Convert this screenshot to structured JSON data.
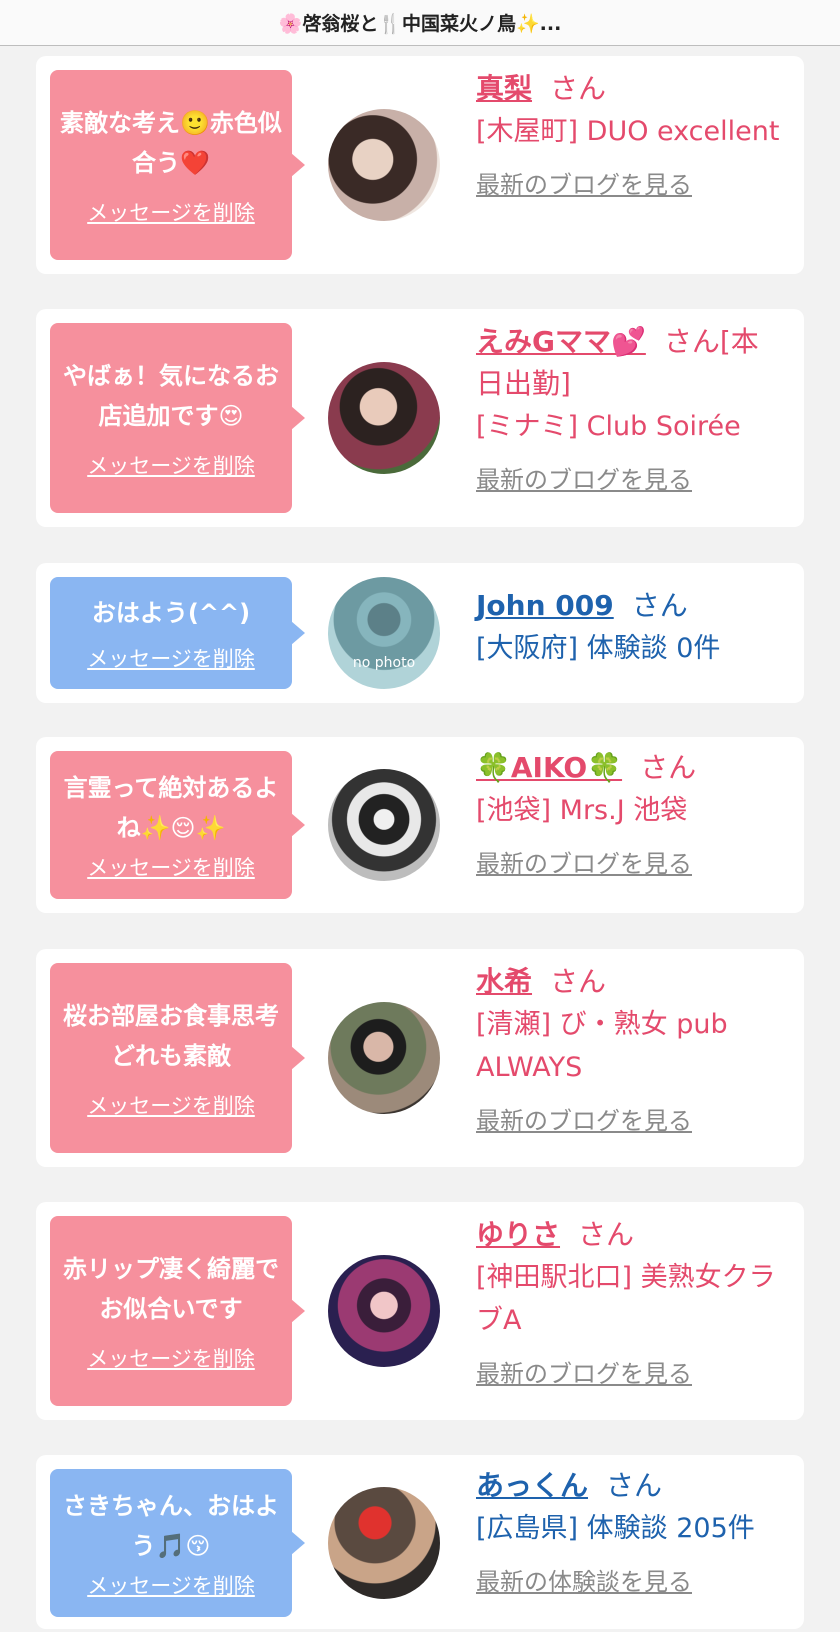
{
  "header": {
    "title": "🌸啓翁桜と🍴中国菜火ノ鳥✨..."
  },
  "colors": {
    "pink_bubble": "#f6909d",
    "blue_bubble": "#8ab6f2",
    "pink_text": "#e44a6c",
    "blue_text": "#1e62ad",
    "link_gray": "#8a8a8a"
  },
  "messages": [
    {
      "message": "素敵な考え🙂赤色似合う❤️",
      "delete_label": "メッセージを削除",
      "name": "真梨",
      "suffix": "さん",
      "shop": "[木屋町] DUO excellent",
      "link": "最新のブログを見る"
    },
    {
      "message": "やばぁ！気になるお店追加です😍",
      "delete_label": "メッセージを削除",
      "name": "えみGママ💕",
      "suffix": "さん[本日出勤]",
      "shop": "[ミナミ] Club Soirée",
      "link": "最新のブログを見る"
    },
    {
      "message": "おはよう(^^)",
      "delete_label": "メッセージを削除",
      "name": "John 009",
      "suffix": "さん",
      "shop": "[大阪府] 体験談 0件",
      "avatar_text": "no photo"
    },
    {
      "message": "言霊って絶対あるよね✨😌✨",
      "delete_label": "メッセージを削除",
      "name": "🍀AIKO🍀",
      "suffix": "さん",
      "shop": "[池袋] Mrs.J 池袋",
      "link": "最新のブログを見る"
    },
    {
      "message": "桜お部屋お食事思考どれも素敵",
      "delete_label": "メッセージを削除",
      "name": "水希",
      "suffix": "さん",
      "shop": "[清瀬] び・熟女 pub ALWAYS",
      "link": "最新のブログを見る"
    },
    {
      "message": "赤リップ凄く綺麗でお似合いです",
      "delete_label": "メッセージを削除",
      "name": "ゆりさ",
      "suffix": "さん",
      "shop": "[神田駅北口] 美熟女クラブA",
      "link": "最新のブログを見る"
    },
    {
      "message": "さきちゃん、おはよう🎵😚",
      "delete_label": "メッセージを削除",
      "name": "あっくん",
      "suffix": "さん",
      "shop": "[広島県] 体験談 205件",
      "link": "最新の体験談を見る"
    }
  ]
}
